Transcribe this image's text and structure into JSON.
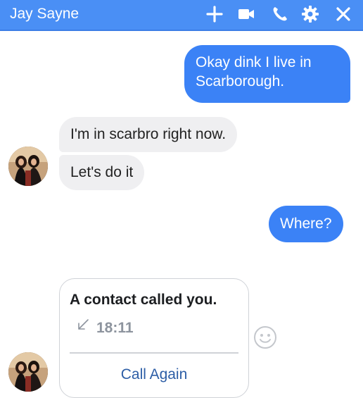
{
  "header": {
    "title": "Jay Sayne",
    "icons": [
      "plus-icon",
      "video-camera-icon",
      "phone-icon",
      "gear-icon",
      "close-icon"
    ],
    "background": "#4a8ff5"
  },
  "messages": [
    {
      "from": "me",
      "lines": [
        "Okay dink I live in",
        "Scarborough."
      ]
    },
    {
      "from": "contact",
      "text": "I'm in scarbro right now."
    },
    {
      "from": "contact",
      "text": "Let's do it"
    },
    {
      "from": "me",
      "text": "Where?"
    }
  ],
  "call_card": {
    "title": "A contact called you.",
    "time": "18:11",
    "action": "Call Again",
    "icon": "incoming-call-arrow-icon"
  },
  "colors": {
    "outgoing_bubble": "#3b82f6",
    "incoming_bubble": "#efeff1",
    "link": "#2d5ea6"
  }
}
